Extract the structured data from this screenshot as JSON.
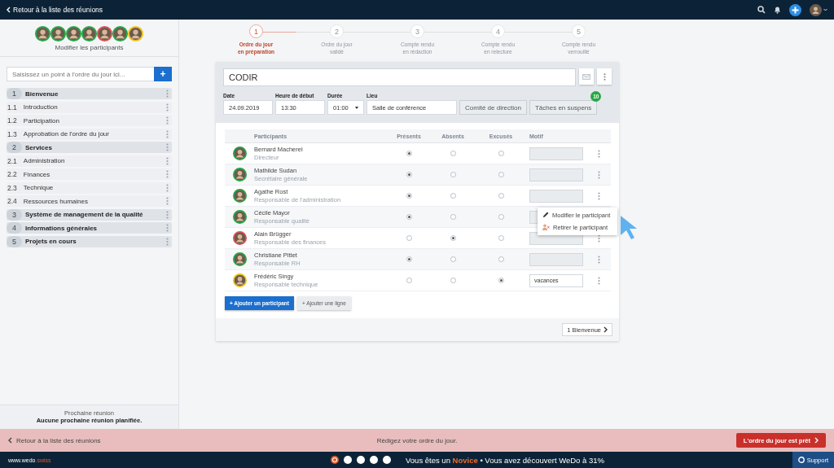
{
  "top_bar": {
    "back_link": "Retour à la liste des réunions"
  },
  "sidebar": {
    "avatars": [
      {
        "color": "#27a745"
      },
      {
        "color": "#27a745"
      },
      {
        "color": "#27a745"
      },
      {
        "color": "#27a745"
      },
      {
        "color": "#d9534f"
      },
      {
        "color": "#27a745"
      },
      {
        "color": "#f0c419"
      }
    ],
    "edit_participants": "Modifier les participants",
    "agenda_input": {
      "placeholder": "Saisissez un point à l'ordre du jour ici..."
    },
    "add_button": "+",
    "agenda": [
      {
        "number": "1",
        "title": "Bienvenue",
        "children": [
          {
            "number": "1.1",
            "title": "Introduction"
          },
          {
            "number": "1.2",
            "title": "Participation"
          },
          {
            "number": "1.3",
            "title": "Approbation de l'ordre du jour"
          }
        ]
      },
      {
        "number": "2",
        "title": "Services",
        "children": [
          {
            "number": "2.1",
            "title": "Administration"
          },
          {
            "number": "2.2",
            "title": "Finances"
          },
          {
            "number": "2.3",
            "title": "Technique"
          },
          {
            "number": "2.4",
            "title": "Ressources humaines"
          }
        ]
      },
      {
        "number": "3",
        "title": "Système de management de la qualité"
      },
      {
        "number": "4",
        "title": "Informations générales"
      },
      {
        "number": "5",
        "title": "Projets en cours"
      }
    ],
    "next_meeting_label": "Prochaine réunion",
    "next_meeting_value": "Aucune prochaine réunion planifiée."
  },
  "steps": [
    {
      "number": "1",
      "label": [
        "Ordre du jour",
        "en préparation"
      ],
      "selected": true
    },
    {
      "number": "2",
      "label": [
        "Ordre du jour",
        "validé"
      ],
      "selected": false
    },
    {
      "number": "3",
      "label": [
        "Compte rendu",
        "en rédaction"
      ],
      "selected": false
    },
    {
      "number": "4",
      "label": [
        "Compte rendu",
        "en relecture"
      ],
      "selected": false
    },
    {
      "number": "5",
      "label": [
        "Compte rendu",
        "verrouillé"
      ],
      "selected": false
    }
  ],
  "meeting": {
    "title": "CODIR",
    "fields": [
      {
        "label": "Date",
        "value": "24.09.2019",
        "kind": "text"
      },
      {
        "label": "Heure de début",
        "value": "13:30",
        "kind": "text"
      },
      {
        "label": "Durée",
        "value": "01:00",
        "kind": "select"
      },
      {
        "label": "Lieu",
        "value": "Salle de conférence",
        "kind": "text"
      }
    ],
    "group_button": "Comité de direction",
    "tasks_button": "Tâches en suspens",
    "tasks_badge": "10"
  },
  "table": {
    "columns": [
      "Participants",
      "Présents",
      "Absents",
      "Excusés",
      "Motif"
    ]
  },
  "participants": [
    {
      "name": "Bernard Macherel",
      "role": "Directeur",
      "present": true,
      "absent": false,
      "excused": false
    },
    {
      "name": "Mathilde Sudan",
      "role": "Secrétaire générale",
      "present": true,
      "absent": false,
      "excused": false
    },
    {
      "name": "Agathe Rost",
      "role": "Responsable de l'administration",
      "present": true,
      "absent": false,
      "excused": false,
      "menu": [
        {
          "label": "Modifier le participant",
          "kind": "edit"
        },
        {
          "label": "Retirer le participant",
          "kind": "remove"
        }
      ]
    },
    {
      "name": "Cécile Mayor",
      "role": "Responsable qualité",
      "present": true,
      "absent": false,
      "excused": false
    },
    {
      "name": "Alain Brügger",
      "role": "Responsable des finances",
      "present": false,
      "absent": true,
      "excused": false
    },
    {
      "name": "Christiane Pittet",
      "role": "Responsable RH",
      "present": true,
      "absent": false,
      "excused": false
    },
    {
      "name": "Frédéric Singy",
      "role": "Responsable technique",
      "present": false,
      "absent": false,
      "excused": true,
      "reason": "vacances"
    }
  ],
  "add_participant": "+ Ajouter un participant",
  "add_line": "+ Ajouter une ligne",
  "next_item": "1 Bienvenue",
  "action_bar": {
    "back_link": "Retour à la liste des réunions",
    "message": "Rédigez votre ordre du jour.",
    "ready_button": "L'ordre du jour est prêt"
  },
  "footer": {
    "site": "www.wedo",
    "site_suffix": ".swiss",
    "progress": [
      {
        "done": true
      },
      {
        "done": false
      },
      {
        "done": false
      },
      {
        "done": false
      },
      {
        "done": false
      }
    ],
    "status_prefix": "Vous êtes un",
    "rank": "Novice",
    "status_suffix": "• Vous avez découvert WeDo à 31%",
    "support": "Support"
  }
}
